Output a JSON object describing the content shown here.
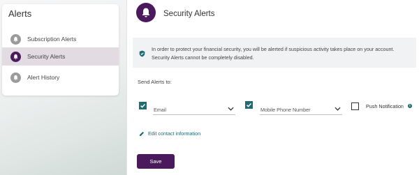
{
  "sidebar": {
    "title": "Alerts",
    "items": [
      {
        "label": "Subscription Alerts",
        "icon": "bell-icon",
        "active": false
      },
      {
        "label": "Security Alerts",
        "icon": "bell-icon",
        "active": true
      },
      {
        "label": "Alert History",
        "icon": "bell-icon",
        "active": false
      }
    ]
  },
  "header": {
    "title": "Security Alerts",
    "icon": "bell-icon"
  },
  "info": {
    "icon": "shield-icon",
    "text": "In order to protect your financial security, you will be alerted if suspicious activity takes place on your account. Security Alerts cannot be completely disabled."
  },
  "send_alerts": {
    "label": "Send Alerts to:",
    "channels": [
      {
        "label": "Email",
        "checked": true,
        "type": "select"
      },
      {
        "label": "Mobile Phone Number",
        "checked": true,
        "type": "select"
      },
      {
        "label": "Push Notification",
        "checked": false,
        "type": "checkbox"
      }
    ]
  },
  "edit_link": {
    "label": "Edit contact information",
    "icon": "pencil-icon"
  },
  "save_button": {
    "label": "Save"
  },
  "colors": {
    "primary": "#4a1a5c",
    "accent": "#1f6b74",
    "active_nav_bg": "#e2dbe2",
    "info_bg": "#f1f2f3"
  }
}
